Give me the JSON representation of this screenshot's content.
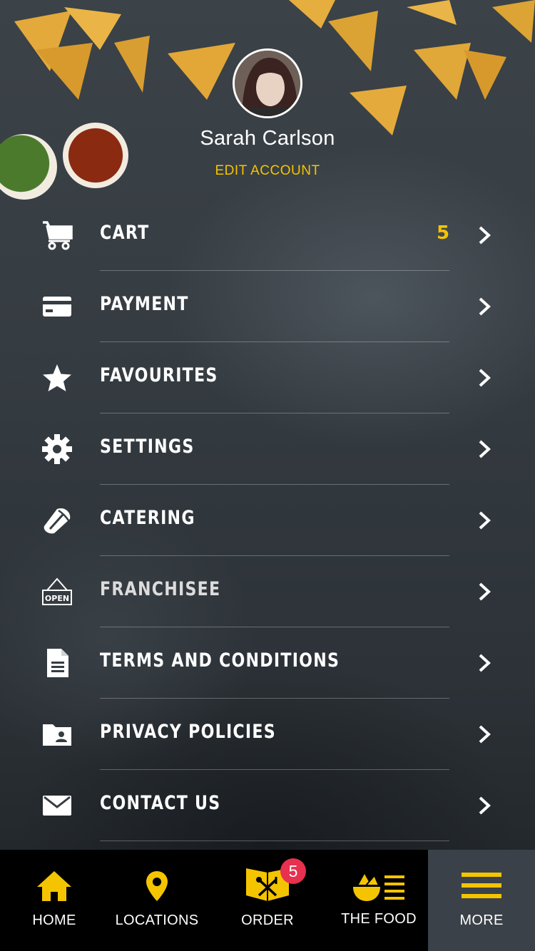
{
  "profile": {
    "name": "Sarah Carlson",
    "edit_label": "EDIT ACCOUNT"
  },
  "menu": {
    "items": [
      {
        "label": "CART",
        "icon": "cart-icon",
        "count": "5"
      },
      {
        "label": "PAYMENT",
        "icon": "credit-card-icon"
      },
      {
        "label": "FAVOURITES",
        "icon": "star-icon"
      },
      {
        "label": "SETTINGS",
        "icon": "gear-icon"
      },
      {
        "label": "CATERING",
        "icon": "burrito-icon"
      },
      {
        "label": "FRANCHISEE",
        "icon": "open-sign-icon",
        "icon_text": "OPEN"
      },
      {
        "label": "TERMS AND CONDITIONS",
        "icon": "document-icon"
      },
      {
        "label": "PRIVACY POLICIES",
        "icon": "folder-user-icon"
      },
      {
        "label": "CONTACT US",
        "icon": "mail-icon"
      }
    ]
  },
  "tabbar": {
    "tabs": [
      {
        "label": "HOME",
        "icon": "home-icon"
      },
      {
        "label": "LOCATIONS",
        "icon": "location-pin-icon"
      },
      {
        "label": "ORDER",
        "icon": "order-menu-icon",
        "badge": "5"
      },
      {
        "label": "THE FOOD",
        "icon": "food-list-icon"
      },
      {
        "label": "MORE",
        "icon": "hamburger-icon",
        "active": true
      }
    ]
  },
  "colors": {
    "accent": "#f5c400",
    "badge": "#e8304f",
    "tabbar": "#000000",
    "active_tab": "#3a4148"
  }
}
